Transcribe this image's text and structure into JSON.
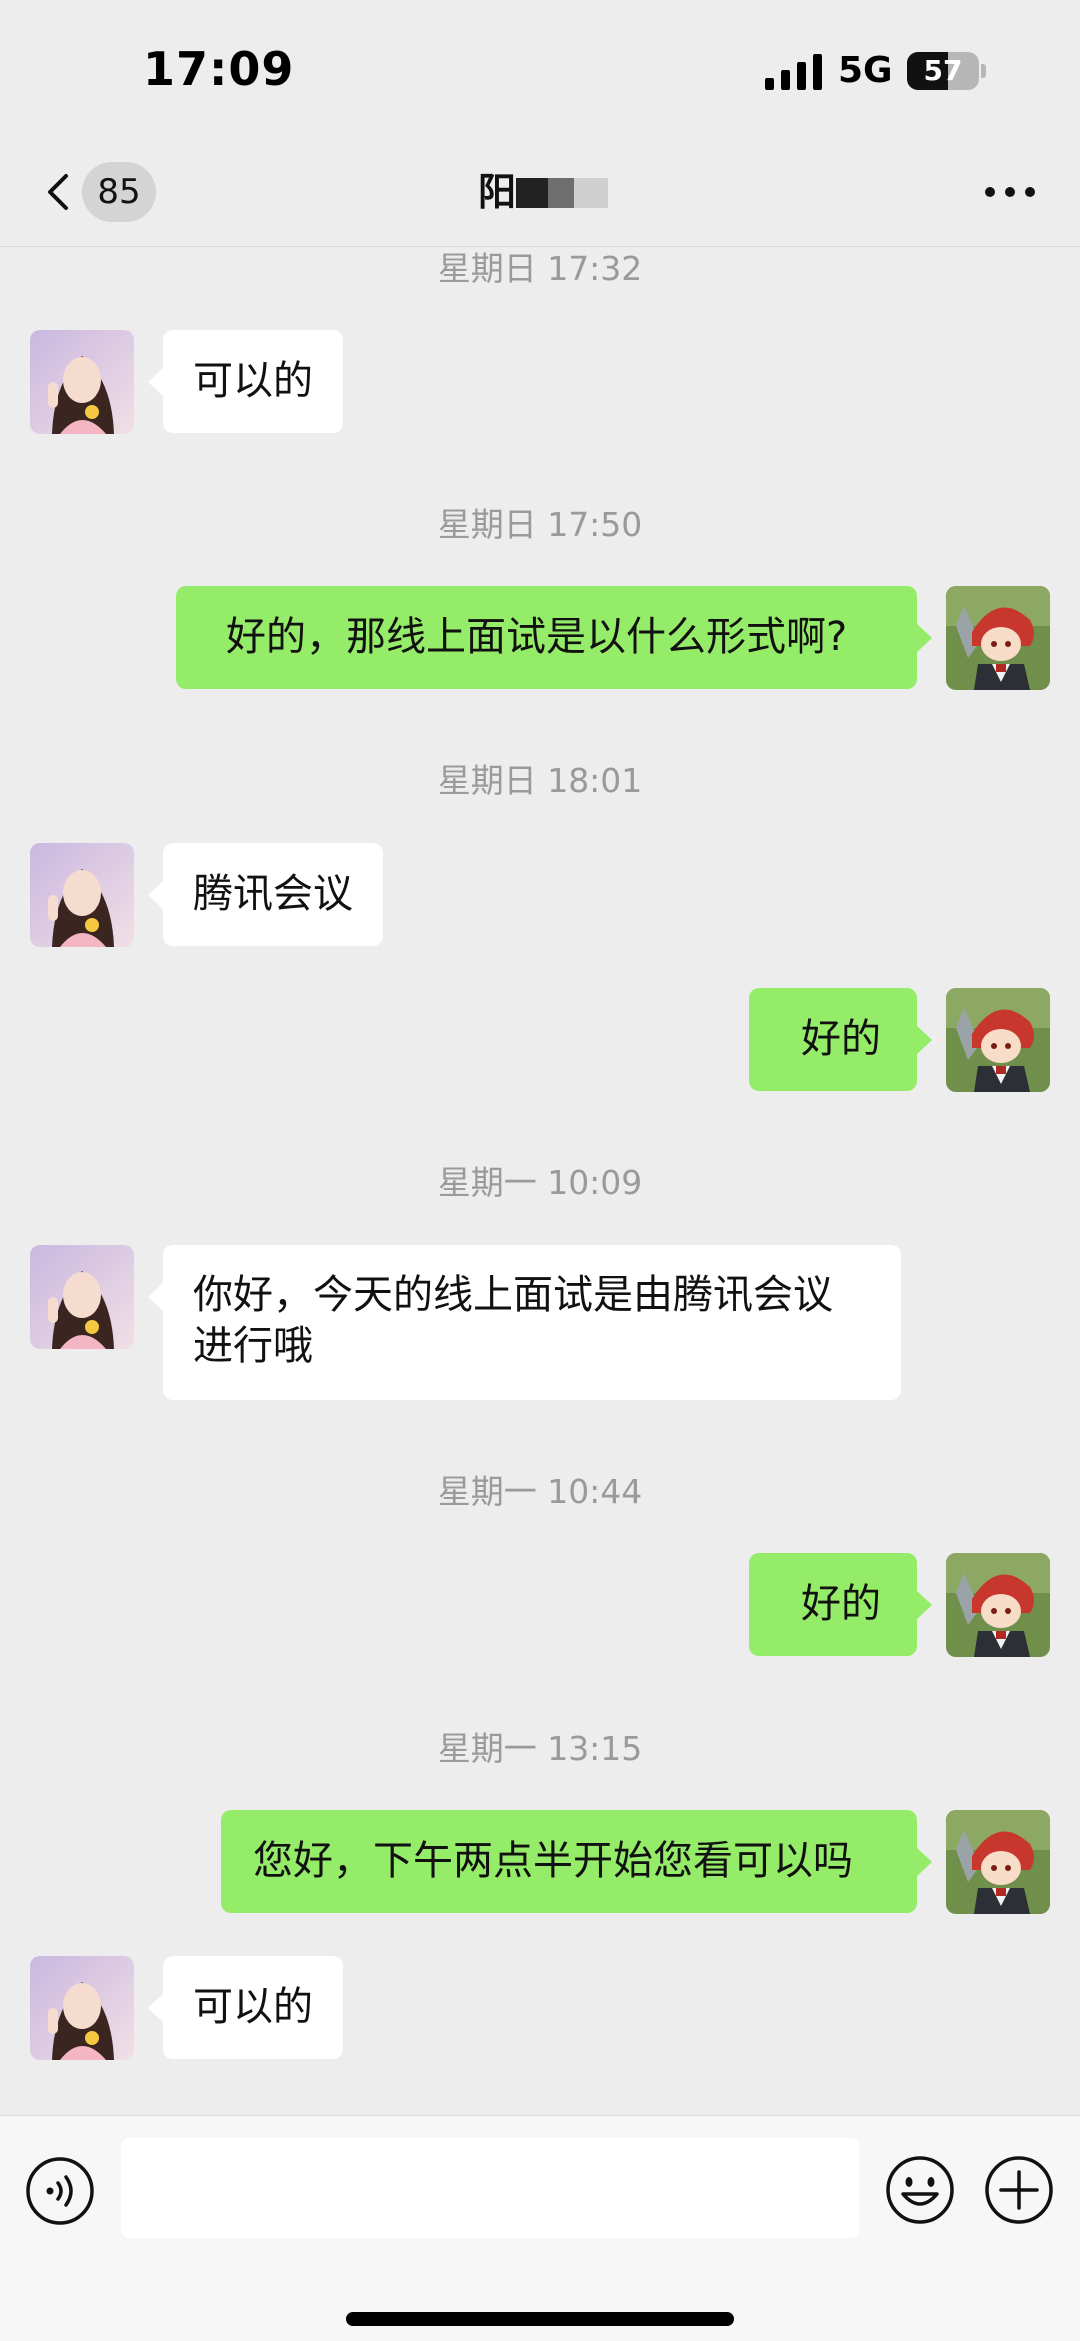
{
  "status_bar": {
    "time": "17:09",
    "network": "5G",
    "battery_level": "57",
    "battery_fraction": 0.57
  },
  "nav": {
    "unread_count": "85",
    "title": "阳",
    "icons": {
      "back": "chevron-left-icon",
      "more": "more-horizontal-icon"
    }
  },
  "messages": [
    {
      "type": "time",
      "text": "星期日 17:32"
    },
    {
      "type": "in",
      "text": "可以的"
    },
    {
      "type": "time",
      "text": "星期日 17:50"
    },
    {
      "type": "out",
      "text": "好的，那线上面试是以什么形式啊?"
    },
    {
      "type": "time",
      "text": "星期日 18:01"
    },
    {
      "type": "in",
      "text": "腾讯会议"
    },
    {
      "type": "out",
      "text": "好的"
    },
    {
      "type": "time",
      "text": "星期一 10:09"
    },
    {
      "type": "in",
      "text": "你好，今天的线上面试是由腾讯会议\n进行哦"
    },
    {
      "type": "time",
      "text": "星期一 10:44"
    },
    {
      "type": "out",
      "text": "好的"
    },
    {
      "type": "time",
      "text": "星期一 13:15"
    },
    {
      "type": "out",
      "text": "您好，下午两点半开始您看可以吗"
    },
    {
      "type": "in",
      "text": "可以的"
    }
  ],
  "input_bar": {
    "placeholder": "",
    "value": "",
    "icons": {
      "voice": "voice-icon",
      "emoji": "emoji-icon",
      "more": "plus-icon"
    }
  },
  "colors": {
    "background": "#ededed",
    "outgoing_bubble": "#95ec69",
    "incoming_bubble": "#ffffff",
    "timestamp_text": "#9a9a9a"
  }
}
